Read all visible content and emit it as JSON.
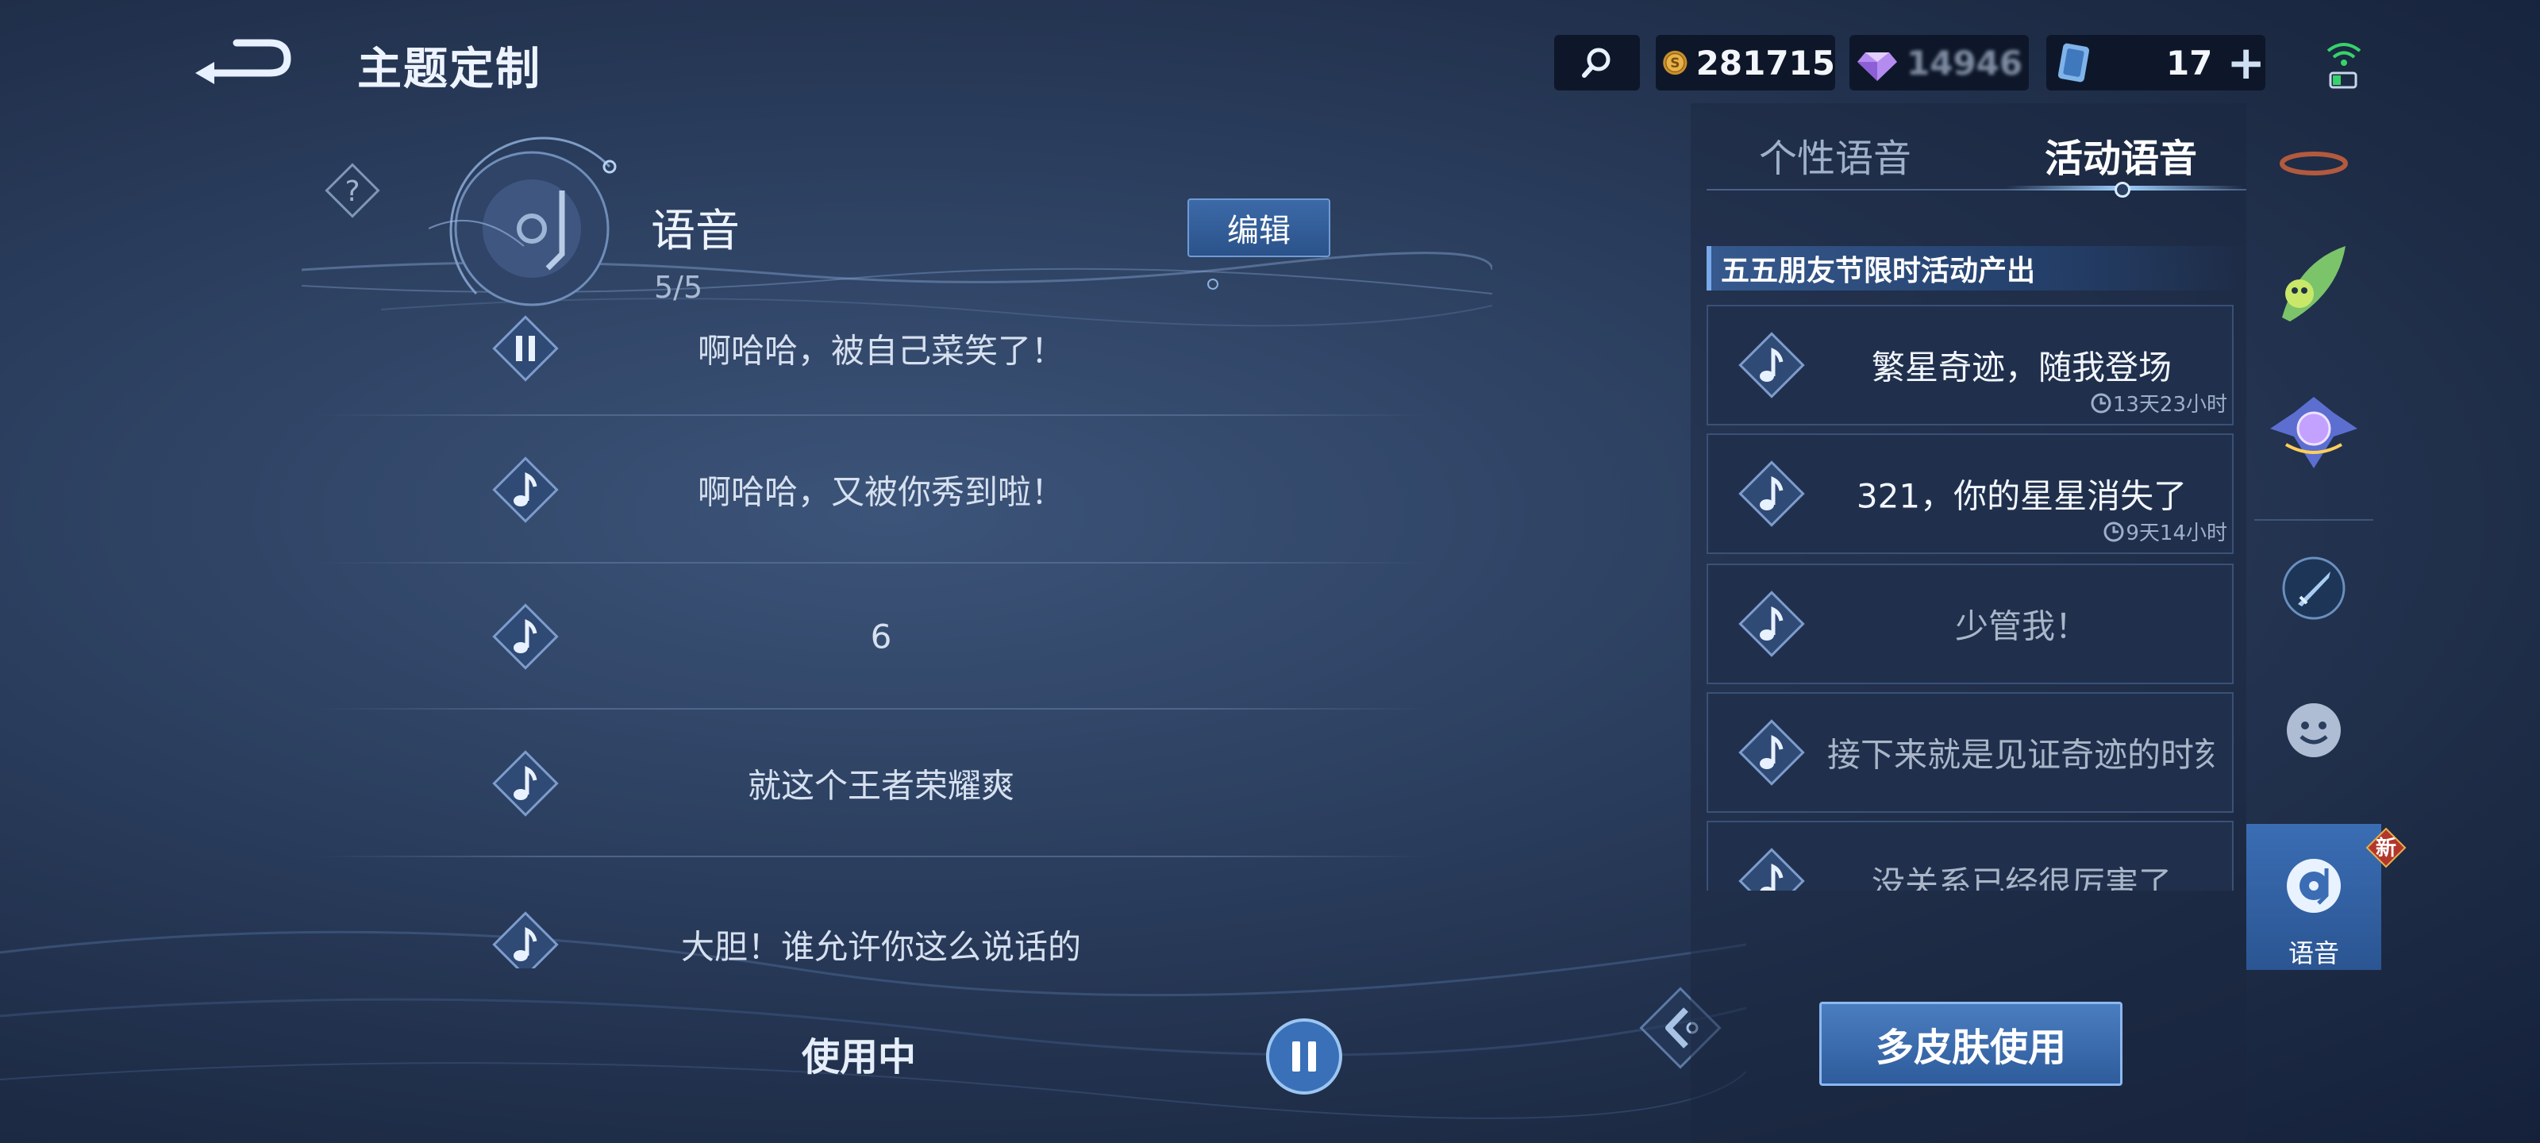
{
  "header": {
    "title": "主题定制",
    "coins": "281715",
    "gems": "14946",
    "tickets": "17",
    "plus_symbol": "+"
  },
  "voice_section": {
    "title": "语音",
    "count": "5/5",
    "edit_label": "编辑",
    "items": [
      {
        "text": "啊哈哈，被自己菜笑了！",
        "state": "playing"
      },
      {
        "text": "啊哈哈，又被你秀到啦！",
        "state": "idle"
      },
      {
        "text": "6",
        "state": "idle"
      },
      {
        "text": "就这个王者荣耀爽",
        "state": "idle"
      },
      {
        "text": "大胆！谁允许你这么说话的",
        "state": "idle"
      }
    ],
    "status": "使用中"
  },
  "right_panel": {
    "tabs": [
      {
        "label": "个性语音",
        "active": false
      },
      {
        "label": "活动语音",
        "active": true
      }
    ],
    "banner": "五五朋友节限时活动产出",
    "items": [
      {
        "text": "繁星奇迹，随我登场",
        "timer": "13天23小时",
        "dim": false
      },
      {
        "text": "321，你的星星消失了",
        "timer": "9天14小时",
        "dim": false
      },
      {
        "text": "少管我！",
        "timer": "",
        "dim": true
      },
      {
        "text": "接下来就是见证奇迹的时刻",
        "timer": "",
        "dim": true
      },
      {
        "text": "没关系已经很厉害了",
        "timer": "",
        "dim": true
      }
    ],
    "multi_button": "多皮肤使用"
  },
  "side_nav": {
    "items": [
      {
        "icon": "ring-icon"
      },
      {
        "icon": "leaf-character-icon"
      },
      {
        "icon": "crest-icon"
      },
      {
        "icon": "sword-icon"
      },
      {
        "icon": "emoji-icon"
      },
      {
        "icon": "voice-disc-icon",
        "label": "语音",
        "active": true
      }
    ],
    "new_badge": "新"
  }
}
